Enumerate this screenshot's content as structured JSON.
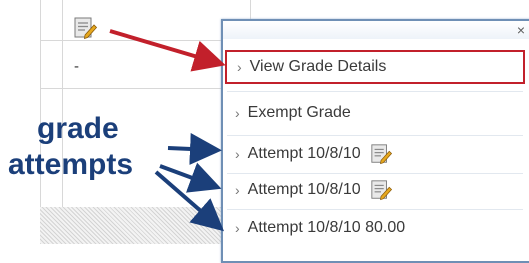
{
  "table": {
    "cell_icon": "edit-grade-icon",
    "empty_cell_text": "-"
  },
  "popup": {
    "close_label": "×",
    "items": [
      {
        "label": "View Grade Details",
        "icon": null,
        "highlighted": true
      },
      {
        "label": "Exempt Grade",
        "icon": null
      },
      {
        "label": "Attempt 10/8/10",
        "icon": "edit-grade-icon"
      },
      {
        "label": "Attempt 10/8/10",
        "icon": "edit-grade-icon"
      },
      {
        "label": "Attempt 10/8/10 80.00",
        "icon": null
      }
    ]
  },
  "annotation": {
    "line1": "grade",
    "line2": "attempts",
    "arrow_color": "#1b3f7a",
    "highlight_arrow_color": "#c2202b",
    "highlight_border_color": "#c2202b"
  },
  "colors": {
    "popup_border": "#6f8fb5",
    "annotation_text": "#1b3f7a"
  }
}
